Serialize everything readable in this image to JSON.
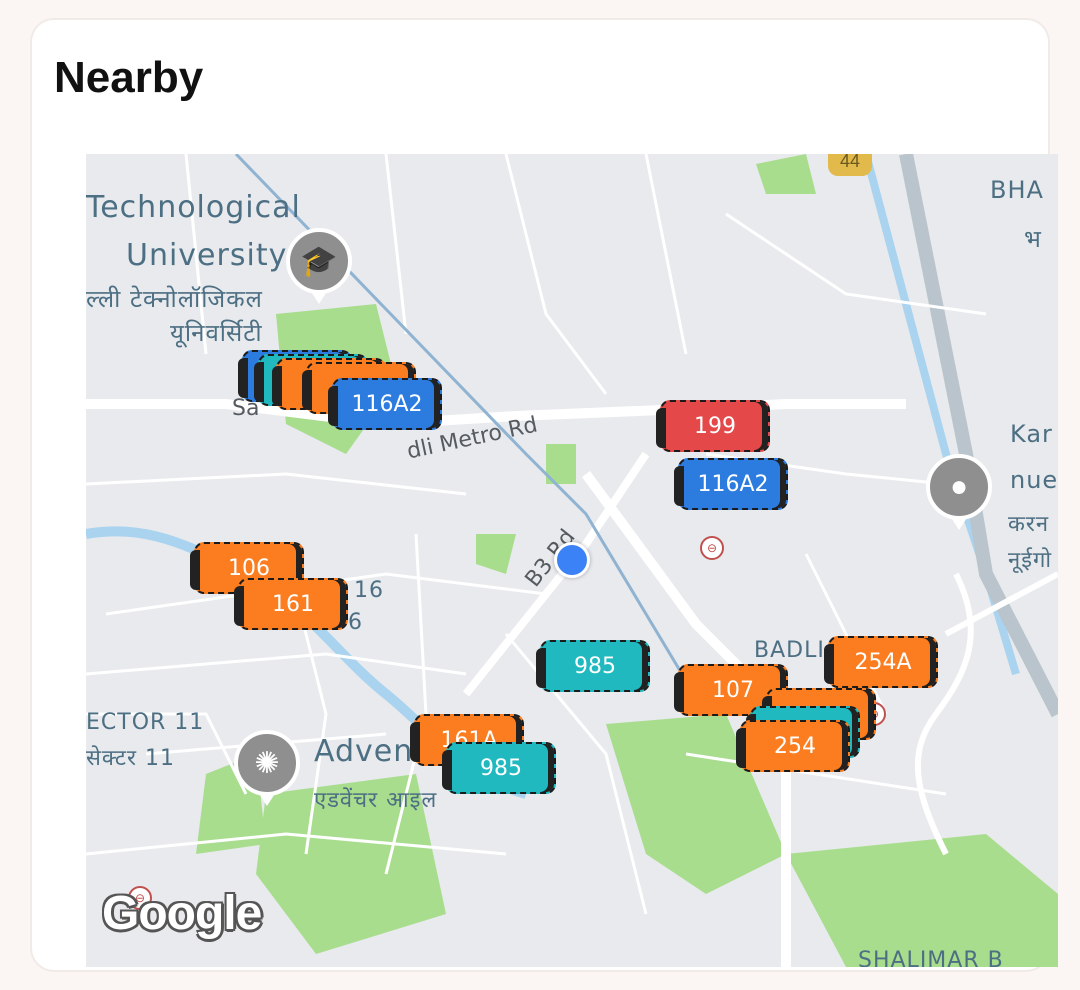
{
  "header": {
    "title": "Nearby"
  },
  "map": {
    "places": {
      "university_en_1": "Technological",
      "university_en_2": "University",
      "university_hi_1": "ल्ली टेक्नोलॉजिकल",
      "university_hi_2": "यूनिवर्सिटी",
      "bha_en": "BHA",
      "bha_hi": "भ",
      "kar_en_1": "Kar",
      "kar_en_2": "nue",
      "kar_hi_1": "करन",
      "kar_hi_2": "नूईगो",
      "sector_en": "ECTOR 11",
      "sector_hi": "सेक्टर 11",
      "advent_en": "Advent",
      "advent_hi": "एडवेंचर आइल",
      "badli_en": "BADLI",
      "shalimar": "SHALIMAR B",
      "num_16a": "16",
      "num_16b": "6"
    },
    "roads": {
      "metro_rd": "dli Metro Rd",
      "b3_rd": "B3 Rd",
      "sanjay": "Sa"
    },
    "highway_badge": "44",
    "attribution": "Google",
    "buses": [
      {
        "route": "116A2",
        "color": "blue"
      },
      {
        "route": "199",
        "color": "red"
      },
      {
        "route": "116A2",
        "color": "blue"
      },
      {
        "route": "106",
        "color": "orange"
      },
      {
        "route": "161",
        "color": "orange"
      },
      {
        "route": "985",
        "color": "teal"
      },
      {
        "route": "254A",
        "color": "orange"
      },
      {
        "route": "107",
        "color": "orange"
      },
      {
        "route": "254",
        "color": "orange"
      },
      {
        "route": "161A",
        "color": "orange"
      },
      {
        "route": "985",
        "color": "teal"
      }
    ]
  },
  "colors": {
    "orange": "#fb7d1f",
    "blue": "#2c7ce0",
    "teal": "#1fb9bf",
    "red": "#e44848",
    "park": "#a8dd8e",
    "water": "#a9d3ef"
  }
}
